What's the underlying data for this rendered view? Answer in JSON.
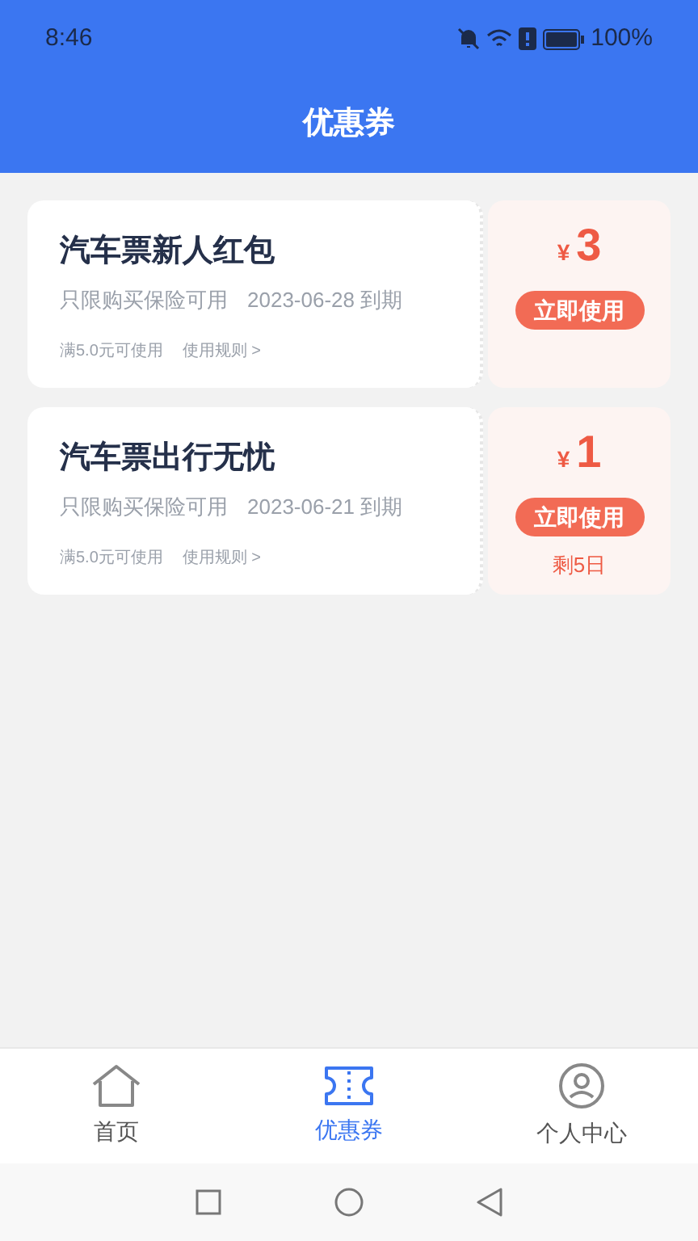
{
  "status_bar": {
    "time": "8:46",
    "battery": "100%"
  },
  "header": {
    "title": "优惠券"
  },
  "coupons": [
    {
      "title": "汽车票新人红包",
      "scope": "只限购买保险可用",
      "expiry": "2023-06-28 到期",
      "condition": "满5.0元可使用",
      "rules_link": "使用规则 >",
      "currency": "¥",
      "amount": "3",
      "use_button": "立即使用"
    },
    {
      "title": "汽车票出行无忧",
      "scope": "只限购买保险可用",
      "expiry": "2023-06-21 到期",
      "condition": "满5.0元可使用",
      "rules_link": "使用规则 >",
      "currency": "¥",
      "amount": "1",
      "use_button": "立即使用",
      "remaining": "剩5日"
    }
  ],
  "tab_bar": [
    {
      "kind": "home",
      "label": "首页",
      "selected": false
    },
    {
      "kind": "coupon",
      "label": "优惠券",
      "selected": true
    },
    {
      "kind": "profile",
      "label": "个人中心",
      "selected": false
    }
  ]
}
